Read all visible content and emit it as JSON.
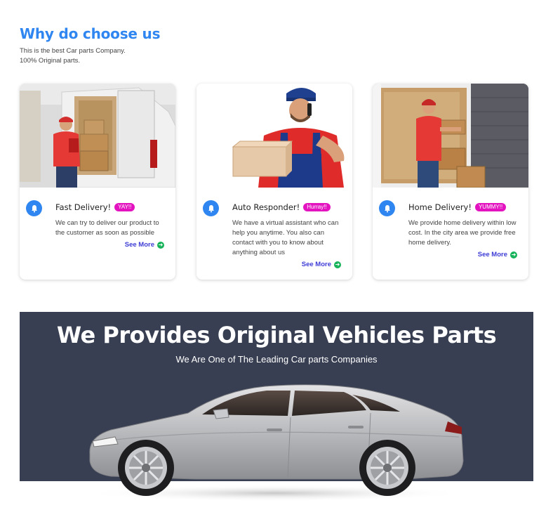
{
  "section": {
    "title": "Why do choose us",
    "subtitle_line1": "This is the best Car parts Company.",
    "subtitle_line2": "100% Original parts."
  },
  "cards": [
    {
      "title": "Fast Delivery!",
      "badge": "YAY!!",
      "icon": "bell-icon",
      "text": "We can try to deliver our product to the customer as soon as possible",
      "link": "See More"
    },
    {
      "title": "Auto Responder!",
      "badge": "Hurray!!",
      "icon": "bell-icon",
      "text": "We have a virtual assistant who can help you anytime. You also can contact with you to know about anything about us",
      "link": "See More"
    },
    {
      "title": "Home Delivery!",
      "badge": "YUMMY!!",
      "icon": "bell-icon",
      "text": "We provide home delivery within low cost. In the city area we provide free home delivery.",
      "link": "See More"
    }
  ],
  "banner": {
    "title": "We Provides Original Vehicles Parts",
    "subtitle": "We Are One of The Leading Car parts Companies"
  },
  "colors": {
    "accent": "#2f86f1",
    "badge": "#e313c0",
    "link": "#3d3cd6",
    "banner_bg": "#383f52",
    "arrow": "#17b35a"
  }
}
